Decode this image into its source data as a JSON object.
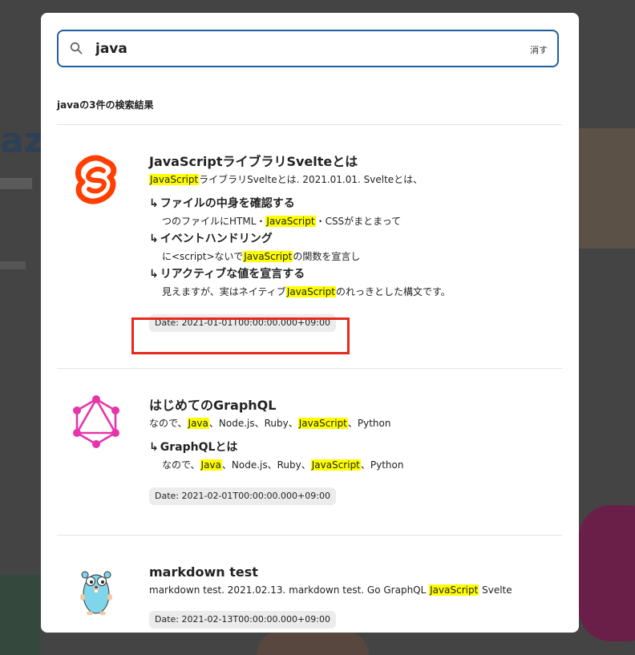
{
  "search": {
    "query": "java",
    "clear_label": "消す",
    "result_count_label": "javaの3件の検索結果"
  },
  "colors": {
    "accent": "#1f5fa0",
    "highlight": "#ffff00",
    "annotation": "#e8281d",
    "svelte": "#ff3e00",
    "graphql": "#e535ab",
    "gopher": "#7fd5ea"
  },
  "results": [
    {
      "icon": "svelte-logo-icon",
      "title": "JavaScriptライブラリSvelteとは",
      "excerpt": {
        "mark": "JavaScript",
        "rest": "ライブラリSvelteとは. 2021.01.01. Svelteとは、"
      },
      "sections": [
        {
          "title": "ファイルの中身を確認する",
          "pre": "つのファイルにHTML・",
          "mark": "JavaScript",
          "post": "・CSSがまとまって"
        },
        {
          "title": "イベントハンドリング",
          "pre": "に<script>ないで",
          "mark": "JavaScript",
          "post": "の関数を宣言し"
        },
        {
          "title": "リアクティブな値を宣言する",
          "pre": "見えますが、実はネイティブ",
          "mark": "JavaScript",
          "post": "のれっきとした構文です。"
        }
      ],
      "date": "Date: 2021-01-01T00:00:00.000+09:00"
    },
    {
      "icon": "graphql-logo-icon",
      "title": "はじめてのGraphQL",
      "excerpt": {
        "a": "なので、",
        "m1": "Java",
        "b": "、Node.js、Ruby、",
        "m2": "JavaScript",
        "c": "、Python"
      },
      "section": {
        "title": "GraphQLとは",
        "a": "なので、",
        "m1": "Java",
        "b": "、Node.js、Ruby、",
        "m2": "JavaScript",
        "c": "、Python"
      },
      "date": "Date: 2021-02-01T00:00:00.000+09:00"
    },
    {
      "icon": "gopher-icon",
      "title": "markdown test",
      "excerpt": {
        "pre": "markdown test. 2021.02.13. markdown test. Go GraphQL ",
        "mark": "JavaScript",
        "post": " Svelte"
      },
      "date": "Date: 2021-02-13T00:00:00.000+09:00"
    }
  ]
}
